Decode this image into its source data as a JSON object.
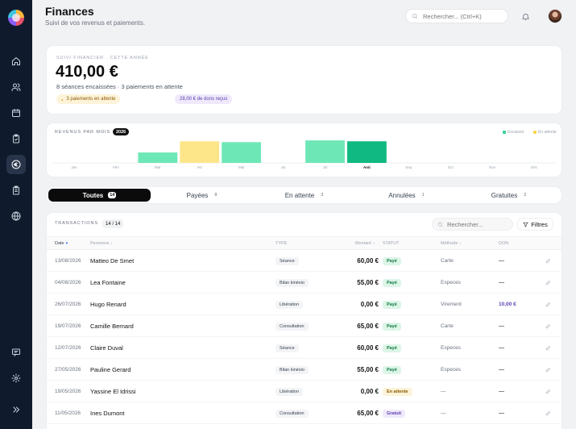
{
  "header": {
    "title": "Finances",
    "subtitle": "Suivi de vos revenus et paiements.",
    "search_placeholder": "Rechercher... (Ctrl+K)"
  },
  "sidebar": {
    "items": [
      {
        "name": "home-icon",
        "active": false
      },
      {
        "name": "users-icon",
        "active": false
      },
      {
        "name": "calendar-icon",
        "active": false
      },
      {
        "name": "clipboard-check-icon",
        "active": false
      },
      {
        "name": "euro-icon",
        "active": true
      },
      {
        "name": "clipboard-list-icon",
        "active": false
      },
      {
        "name": "globe-icon",
        "active": false
      }
    ],
    "bottom": [
      "chat-icon",
      "settings-icon",
      "collapse-icon"
    ]
  },
  "summary": {
    "kicker": "SUIVI FINANCIER · CETTE ANNÉE",
    "amount": "410,00 €",
    "description": "8 séances encaissées · 3 paiements en attente",
    "pending_pill": "3 paiements en attente",
    "dons_pill": "28,00 € de dons reçus"
  },
  "chart_data": {
    "type": "bar",
    "title": "REVENUS PAR MOIS",
    "year_badge": "2026",
    "categories": [
      "Jan",
      "Fév",
      "Mar",
      "Avr",
      "Mai",
      "Jui",
      "Jul",
      "Aoû",
      "Sep",
      "Oct",
      "Nov",
      "Déc"
    ],
    "highlight": "Aoû",
    "series": [
      {
        "name": "Encaissé",
        "color": "#6ee7b7",
        "values": [
          0,
          0,
          60,
          0,
          120,
          0,
          130,
          125,
          0,
          0,
          0,
          0
        ]
      },
      {
        "name": "En attente",
        "color": "#fde68a",
        "values": [
          0,
          0,
          0,
          125,
          0,
          0,
          0,
          0,
          0,
          0,
          0,
          0
        ]
      }
    ],
    "highlight_color": "#10b981",
    "ylim": [
      0,
      140
    ],
    "grid": false,
    "legend": "top-right"
  },
  "tabs": [
    {
      "label": "Toutes",
      "count": "14",
      "active": true
    },
    {
      "label": "Payées",
      "count": "8",
      "active": false
    },
    {
      "label": "En attente",
      "count": "3",
      "active": false
    },
    {
      "label": "Annulées",
      "count": "1",
      "active": false
    },
    {
      "label": "Gratuites",
      "count": "2",
      "active": false
    }
  ],
  "transactions": {
    "kicker": "TRANSACTIONS",
    "count": "14 / 14",
    "search_placeholder": "Rechercher...",
    "filter_label": "Filtres",
    "columns": {
      "date": "Date",
      "person": "Personne",
      "type": "TYPE",
      "amount": "Montant",
      "status": "STATUT",
      "method": "Méthode",
      "don": "DON"
    },
    "rows": [
      {
        "date": "13/08/2026",
        "name": "Matteo De Smet",
        "type": "Séance",
        "amount": "60,00 €",
        "status": "Payé",
        "status_kind": "paye",
        "method": "Carte",
        "don": "—"
      },
      {
        "date": "04/08/2026",
        "name": "Lea Fontaine",
        "type": "Bilan kinésio",
        "amount": "55,00 €",
        "status": "Payé",
        "status_kind": "paye",
        "method": "Especes",
        "don": "—"
      },
      {
        "date": "26/07/2026",
        "name": "Hugo Renard",
        "type": "Libération",
        "amount": "0,00 €",
        "status": "Payé",
        "status_kind": "paye",
        "method": "Virement",
        "don": "10,00 €"
      },
      {
        "date": "19/07/2026",
        "name": "Camille Bernard",
        "type": "Consultation",
        "amount": "65,00 €",
        "status": "Payé",
        "status_kind": "paye",
        "method": "Carte",
        "don": "—"
      },
      {
        "date": "12/07/2026",
        "name": "Claire Duval",
        "type": "Séance",
        "amount": "60,00 €",
        "status": "Payé",
        "status_kind": "paye",
        "method": "Especes",
        "don": "—"
      },
      {
        "date": "27/05/2026",
        "name": "Pauline Gerard",
        "type": "Bilan kinésio",
        "amount": "55,00 €",
        "status": "Payé",
        "status_kind": "paye",
        "method": "Especes",
        "don": "—"
      },
      {
        "date": "19/05/2026",
        "name": "Yassine El Idrissi",
        "type": "Libération",
        "amount": "0,00 €",
        "status": "En attente",
        "status_kind": "attente",
        "method": "—",
        "don": "—"
      },
      {
        "date": "11/05/2026",
        "name": "Ines Dumont",
        "type": "Consultation",
        "amount": "65,00 €",
        "status": "Gratuit",
        "status_kind": "gratuit",
        "method": "—",
        "don": "—"
      }
    ]
  }
}
